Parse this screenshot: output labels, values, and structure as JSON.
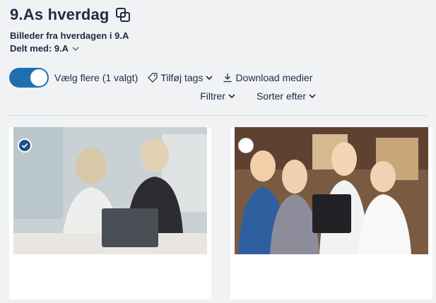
{
  "album": {
    "title": "9.As hverdag",
    "description": "Billeder fra hverdagen i 9.A",
    "shared_label": "Delt med: 9.A"
  },
  "toolbar": {
    "select_multiple_label": "Vælg flere (1 valgt)",
    "select_multiple_on": true,
    "add_tags_label": "Tilføj tags",
    "download_label": "Download medier",
    "filter_label": "Filtrer",
    "sort_label": "Sorter efter"
  },
  "media": [
    {
      "selected": true,
      "icon": "check-icon"
    },
    {
      "selected": false,
      "icon": "radio-empty-icon"
    }
  ],
  "colors": {
    "accent": "#1f6fb0",
    "check": "#1f4f8a",
    "text": "#1f2a44",
    "background": "#f0f2f4"
  }
}
